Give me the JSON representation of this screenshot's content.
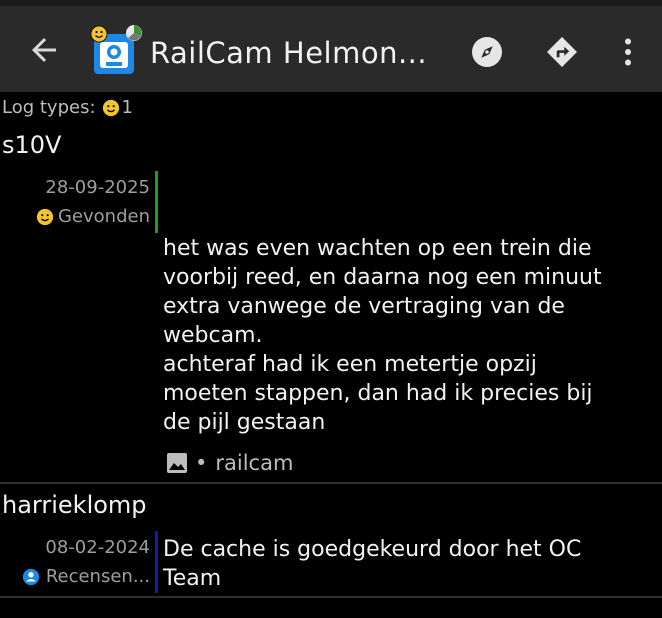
{
  "header": {
    "title": "RailCam Helmon..."
  },
  "summary": {
    "label": "Log types:",
    "found_count": "1"
  },
  "logs": [
    {
      "user": "s10V",
      "date": "28-09-2025",
      "type": "Gevonden",
      "type_color": "#1aa31a",
      "text": "het was even wachten op een trein die\nvoorbij reed, en daarna nog een minuut\nextra vanwege de vertraging van de\nwebcam.\nachteraf had ik een metertje opzij\nmoeten stappen, dan had ik precies bij\nde pijl gestaan",
      "attachment_label": "railcam",
      "attachment_sep": "•"
    },
    {
      "user": "harrieklomp",
      "date": "08-02-2024",
      "type": "Recensen...",
      "type_color": "#1a1aa8",
      "text": "De cache is goedgekeurd door het OC\nTeam"
    }
  ]
}
